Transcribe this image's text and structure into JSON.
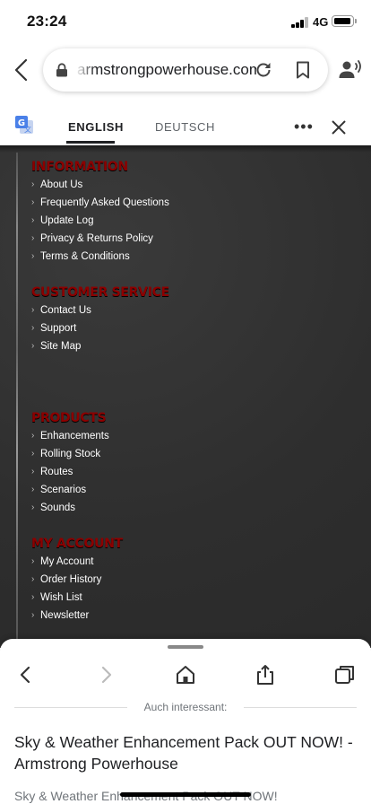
{
  "status_bar": {
    "time": "23:24",
    "network": "4G",
    "battery_icon": "battery-icon",
    "signal_icon": "signal-bars-icon"
  },
  "browser": {
    "url": "armstrongpowerhouse.com",
    "icons": {
      "back": "chevron-left-icon",
      "lock": "lock-icon",
      "reload": "reload-icon",
      "bookmark": "bookmark-icon",
      "voice": "voice-search-icon"
    }
  },
  "translate_bar": {
    "icon": "google-translate-icon",
    "tabs": [
      {
        "label": "ENGLISH",
        "active": true
      },
      {
        "label": "DEUTSCH",
        "active": false
      }
    ],
    "more_label": "•••",
    "close_icon": "close-icon"
  },
  "footer": {
    "accent_color": "#8c0000",
    "sections": [
      {
        "title": "INFORMATION",
        "links": [
          "About Us",
          "Frequently Asked Questions",
          "Update Log",
          "Privacy & Returns Policy",
          "Terms & Conditions"
        ]
      },
      {
        "title": "CUSTOMER SERVICE",
        "links": [
          "Contact Us",
          "Support",
          "Site Map"
        ]
      },
      {
        "title": "PRODUCTS",
        "links": [
          "Enhancements",
          "Rolling Stock",
          "Routes",
          "Scenarios",
          "Sounds"
        ]
      },
      {
        "title": "MY ACCOUNT",
        "links": [
          "My Account",
          "Order History",
          "Wish List",
          "Newsletter"
        ]
      }
    ]
  },
  "bottom_sheet": {
    "nav_icons": [
      "back-arrow-icon",
      "forward-arrow-icon",
      "home-icon",
      "share-icon",
      "tabs-icon"
    ],
    "see_also": "Auch interessant:",
    "article_title": "Sky & Weather Enhancement Pack OUT NOW! - Armstrong Powerhouse",
    "article_subtitle": "Sky & Weather Enhancement Pack OUT NOW!"
  }
}
